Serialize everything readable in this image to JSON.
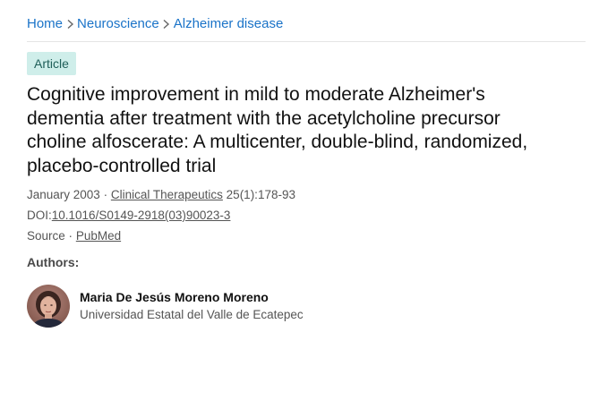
{
  "breadcrumb": {
    "items": [
      "Home",
      "Neuroscience",
      "Alzheimer disease"
    ]
  },
  "article": {
    "type_badge": "Article",
    "title": "Cognitive improvement in mild to moderate Alzheimer's dementia after treatment with the acetylcholine precursor choline alfoscerate: A multicenter, double-blind, randomized, placebo-controlled trial",
    "date": "January 2003",
    "separator": "·",
    "journal": "Clinical Therapeutics",
    "volume_pages": "25(1):178-93",
    "doi_label": "DOI:",
    "doi": "10.1016/S0149-2918(03)90023-3",
    "source_label": "Source",
    "source": "PubMed"
  },
  "authors": {
    "heading": "Authors:",
    "list": [
      {
        "name": "Maria De Jesús Moreno Moreno",
        "affiliation": "Universidad Estatal del Valle de Ecatepec",
        "avatar_icon": "author-photo"
      }
    ]
  },
  "colors": {
    "link": "#1a73c8",
    "badge_bg": "#cfeeea",
    "badge_text": "#1f5f59",
    "meta_text": "#555555"
  }
}
